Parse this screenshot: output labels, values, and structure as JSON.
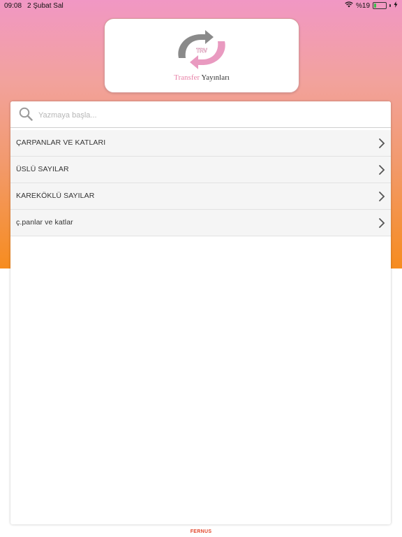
{
  "status_bar": {
    "time": "09:08",
    "date": "2 Şubat Sal",
    "battery": "%19",
    "battery_level": 0.19
  },
  "logo": {
    "badge_text": "TRV",
    "brand_first": "Transfer",
    "brand_second": "Yayınları"
  },
  "search": {
    "placeholder": "Yazmaya başla...",
    "value": ""
  },
  "list": {
    "items": [
      {
        "label": "ÇARPANLAR VE KATLARI"
      },
      {
        "label": "ÜSLÜ SAYILAR"
      },
      {
        "label": "KAREKÖKLÜ SAYILAR"
      },
      {
        "label": "ç.panlar ve katlar"
      }
    ]
  },
  "footer": {
    "brand": "FERNUS"
  },
  "colors": {
    "gradient_top": "#f197c4",
    "gradient_bottom": "#f68c1f",
    "brand_pink": "#e883a8",
    "footer_red": "#e2462b"
  },
  "icons": {
    "search": "search-icon",
    "chevron": "chevron-right-icon",
    "wifi": "wifi-icon",
    "battery": "battery-icon",
    "charging": "charging-bolt-icon"
  }
}
